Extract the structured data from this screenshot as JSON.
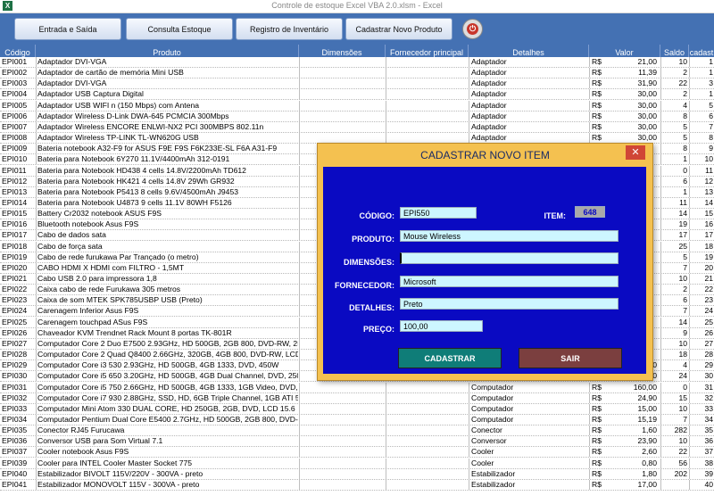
{
  "window": {
    "title": "Controle de estoque Excel VBA 2.0.xlsm  -  Excel",
    "app_icon": "X"
  },
  "toolbar": {
    "buttons": [
      "Entrada e Saída",
      "Consulta Estoque",
      "Registro de Inventário",
      "Cadastrar Novo Produto"
    ],
    "power_icon": "power-icon"
  },
  "table": {
    "headers": [
      "Código",
      "Produto",
      "Dimensões",
      "Fornecedor principal",
      "Detalhes",
      "Valor",
      "Saldo",
      "cadast"
    ],
    "rows": [
      [
        "EPI001",
        "Adaptador DVI-VGA",
        "",
        "",
        "Adaptador",
        "R$",
        "21,00",
        "10",
        "1"
      ],
      [
        "EPI002",
        "Adaptador de cartão de memória Mini USB",
        "",
        "",
        "Adaptador",
        "R$",
        "11,39",
        "2",
        "1"
      ],
      [
        "EPI003",
        "Adaptador DVI-VGA",
        "",
        "",
        "Adaptador",
        "R$",
        "31,90",
        "22",
        "3"
      ],
      [
        "EPI004",
        "Adaptador USB Captura Digital",
        "",
        "",
        "Adaptador",
        "R$",
        "30,00",
        "2",
        "1"
      ],
      [
        "EPI005",
        "Adaptador USB WIFI n (150 Mbps) com Antena",
        "",
        "",
        "Adaptador",
        "R$",
        "30,00",
        "4",
        "5"
      ],
      [
        "EPI006",
        "Adaptador Wireless D-Link DWA-645 PCMCIA 300Mbps",
        "",
        "",
        "Adaptador",
        "R$",
        "30,00",
        "8",
        "6"
      ],
      [
        "EPI007",
        "Adaptador Wireless ENCORE ENLWI-NX2 PCI 300MBPS 802.11n",
        "",
        "",
        "Adaptador",
        "R$",
        "30,00",
        "5",
        "7"
      ],
      [
        "EPI008",
        "Adaptador Wireless TP-LINK TL-WN620G USB",
        "",
        "",
        "Adaptador",
        "R$",
        "30,00",
        "5",
        "8"
      ],
      [
        "EPI009",
        "Bateria notebook A32-F9 for ASUS F9E F9S F6K233E-SL F6A A31-F9",
        "",
        "",
        "",
        "",
        "",
        "8",
        "9"
      ],
      [
        "EPI010",
        "Bateria para Notebook 6Y270 11.1V/4400mAh 312-0191",
        "",
        "",
        "",
        "",
        "",
        "1",
        "10"
      ],
      [
        "EPI011",
        "Bateria para Notebook HD438 4 cells 14.8V/2200mAh TD612",
        "",
        "",
        "",
        "",
        "",
        "0",
        "11"
      ],
      [
        "EPI012",
        "Bateria para Notebook HK421 4 cells 14.8V 29Wh GR932",
        "",
        "",
        "",
        "",
        "",
        "6",
        "12"
      ],
      [
        "EPI013",
        "Bateria para Notebook P5413 8 cells 9.6V/4500mAh J9453",
        "",
        "",
        "",
        "",
        "",
        "1",
        "13"
      ],
      [
        "EPI014",
        "Bateria para Notebook U4873 9 cells 11.1V 80WH F5126",
        "",
        "",
        "",
        "",
        "",
        "11",
        "14"
      ],
      [
        "EPI015",
        "Battery Cr2032 notebook ASUS F9S",
        "",
        "",
        "",
        "",
        "",
        "14",
        "15"
      ],
      [
        "EPI016",
        "Bluetooth notebook Asus F9S",
        "",
        "",
        "",
        "",
        "",
        "19",
        "16"
      ],
      [
        "EPI017",
        "Cabo de dados sata",
        "",
        "",
        "",
        "",
        "",
        "17",
        "17"
      ],
      [
        "EPI018",
        "Cabo de força sata",
        "",
        "",
        "",
        "",
        "",
        "25",
        "18"
      ],
      [
        "EPI019",
        "Cabo de rede furukawa Par Trançado (o metro)",
        "",
        "",
        "",
        "",
        "",
        "5",
        "19"
      ],
      [
        "EPI020",
        "CABO HDMI X HDMI com FILTRO - 1,5MT",
        "",
        "",
        "",
        "",
        "",
        "7",
        "20"
      ],
      [
        "EPI021",
        "Cabo USB 2.0 para impressora 1,8",
        "",
        "",
        "",
        "",
        "",
        "10",
        "21"
      ],
      [
        "EPI022",
        "Caixa cabo de rede Furukawa 305 metros",
        "",
        "",
        "",
        "",
        "",
        "2",
        "22"
      ],
      [
        "EPI023",
        "Caixa de som MTEK SPK785USBP USB (Preto)",
        "",
        "",
        "",
        "",
        "",
        "6",
        "23"
      ],
      [
        "EPI024",
        "Carenagem Inferior Asus F9S",
        "",
        "",
        "",
        "",
        "",
        "7",
        "24"
      ],
      [
        "EPI025",
        "Carenagem touchpad ASus F9S",
        "",
        "",
        "",
        "",
        "",
        "14",
        "25"
      ],
      [
        "EPI026",
        "Chaveador KVM Trendnet Rack Mount 8 portas TK-801R",
        "",
        "",
        "",
        "",
        "",
        "9",
        "26"
      ],
      [
        "EPI027",
        "Computador Core 2 Duo E7500 2.93GHz, HD 500GB, 2GB 800, DVD-RW, 250W",
        "",
        "",
        "",
        "",
        "",
        "10",
        "27"
      ],
      [
        "EPI028",
        "Computador Core 2 Quad Q8400 2.66GHz, 320GB, 4GB 800, DVD-RW, LCD 19",
        "",
        "",
        "",
        "",
        "",
        "18",
        "28"
      ],
      [
        "EPI029",
        "Computador Core i3 530 2.93GHz, HD 500GB, 4GB 1333, DVD, 450W",
        "",
        "",
        "",
        "",
        "21,90",
        "4",
        "29"
      ],
      [
        "EPI030",
        "Computador Core i5 650 3.20GHz, HD 500GB, 4GB Dual Channel, DVD, 250W",
        "",
        "",
        "Computador",
        "R$",
        "19,50",
        "24",
        "30"
      ],
      [
        "EPI031",
        "Computador Core i5 750 2.66GHz, HD 500GB, 4GB 1333, 1GB Video, DVD, 350W",
        "",
        "",
        "Computador",
        "R$",
        "160,00",
        "0",
        "31"
      ],
      [
        "EPI032",
        "Computador Core i7 930 2.88GHz, SSD, HD, 6GB Triple Channel, 1GB ATI 5830, DVD",
        "",
        "",
        "Computador",
        "R$",
        "24,90",
        "15",
        "32"
      ],
      [
        "EPI033",
        "Computador Mini Atom 330 DUAL CORE, HD 250GB, 2GB, DVD, LCD 15.6",
        "",
        "",
        "Computador",
        "R$",
        "15,00",
        "10",
        "33"
      ],
      [
        "EPI034",
        "Computador Pentium Dual Core E5400 2.7GHz, HD 500GB, 2GB 800, DVD-RW",
        "",
        "",
        "Computador",
        "R$",
        "15,19",
        "7",
        "34"
      ],
      [
        "EPI035",
        "Conector RJ45 Furucawa",
        "",
        "",
        "Conector",
        "R$",
        "1,60",
        "282",
        "35"
      ],
      [
        "EPI036",
        "Conversor USB para Som Virtual 7.1",
        "",
        "",
        "Conversor",
        "R$",
        "23,90",
        "10",
        "36"
      ],
      [
        "EPI037",
        "Cooler notebook Asus F9S",
        "",
        "",
        "Cooler",
        "R$",
        "2,60",
        "22",
        "37"
      ],
      [
        "EPI039",
        "Cooler para INTEL Cooler Master Socket 775",
        "",
        "",
        "Cooler",
        "R$",
        "0,80",
        "56",
        "38"
      ],
      [
        "EPI040",
        "Estabilizador BIVOLT 115V/220V - 300VA - preto",
        "",
        "",
        "Estabilizador",
        "R$",
        "1,80",
        "202",
        "39"
      ],
      [
        "EPI041",
        "Estabilizador MONOVOLT 115V - 300VA - preto",
        "",
        "",
        "Estabilizador",
        "R$",
        "17,00",
        "",
        "40"
      ]
    ]
  },
  "dialog": {
    "title": "CADASTRAR NOVO ITEM",
    "close_label": "✕",
    "labels": {
      "codigo": "CÓDIGO:",
      "item": "ITEM:",
      "produto": "PRODUTO:",
      "dimensoes": "DIMENSÕES:",
      "fornecedor": "FORNECEDOR:",
      "detalhes": "DETALHES:",
      "preco": "PREÇO:"
    },
    "values": {
      "codigo": "EPI550",
      "item": "648",
      "produto": "Mouse Wireless",
      "dimensoes": "",
      "fornecedor": "Microsoft",
      "detalhes": "Preto",
      "preco": "100,00"
    },
    "buttons": {
      "cadastrar": "CADASTRAR",
      "sair": "SAIR"
    },
    "colors": {
      "frame": "#f4c150",
      "body": "#0a0ac2",
      "field": "#cdf6ff",
      "cadastrar": "#0f7d78",
      "sair": "#7b3f3f"
    }
  }
}
